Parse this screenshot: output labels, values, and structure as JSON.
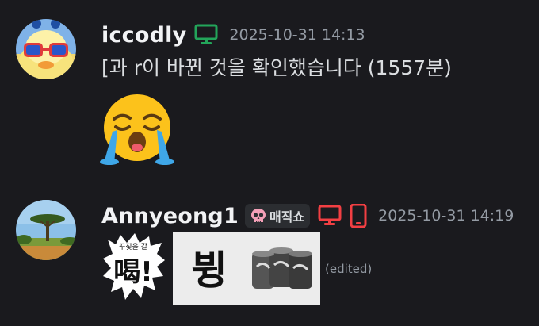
{
  "messages": [
    {
      "username": "iccodly",
      "timestamp": "2025-10-31 14:13",
      "device_icons": [
        "desktop-icon"
      ],
      "text": "[과 r이 바뀐 것을 확인했습니다 (1557분)",
      "emoji": "loudly-crying-face-emoji"
    },
    {
      "username": "Annyeong1",
      "role_tag": {
        "icon": "pink-skull-icon",
        "label": "매직쇼"
      },
      "timestamp": "2025-10-31 14:19",
      "device_icons": [
        "desktop-icon",
        "mobile-icon"
      ],
      "stickers": [
        {
          "name": "shout-sticker",
          "small_text": "꾸짖을 갈",
          "big_text": "喝!"
        },
        {
          "name": "boong-sticker",
          "text": "뷩"
        }
      ],
      "edited_label": "(edited)"
    }
  ],
  "colors": {
    "background": "#1a1a1e",
    "username": "#f2f3f5",
    "timestamp": "#949ba4",
    "online_desktop": "#23a55a",
    "dnd_red": "#f23f43"
  }
}
